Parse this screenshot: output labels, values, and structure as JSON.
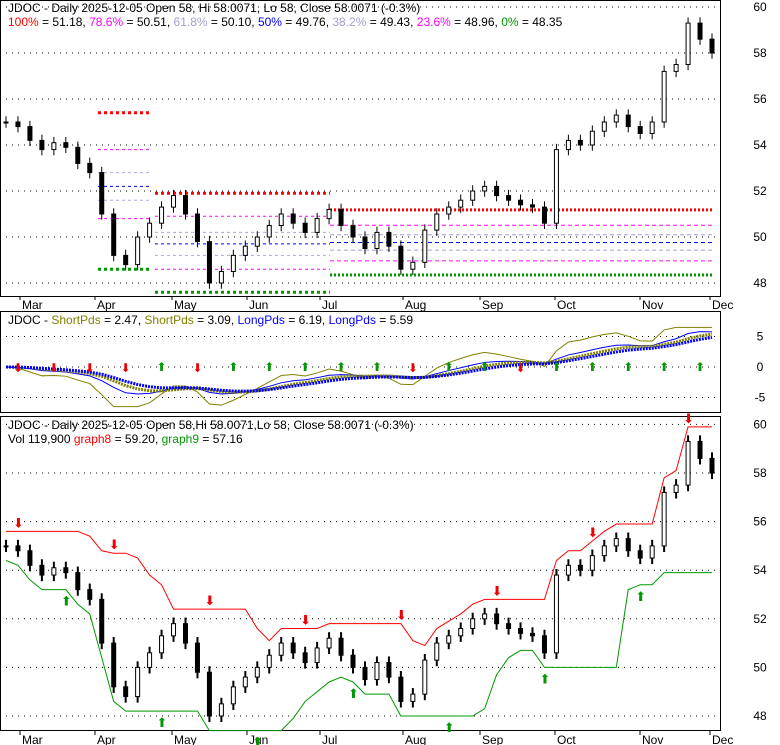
{
  "chart_data": {
    "type": "line",
    "panels": [
      {
        "name": "price",
        "title": "JDOC - Daily 2025-12-05 Open 58, Hi 58.0071, Lo 58, Close 58.0071 (-0.3%)",
        "ylim": [
          47.5,
          60.2
        ],
        "yticks": [
          "48",
          "50",
          "52",
          "54",
          "56",
          "58",
          "60"
        ]
      },
      {
        "name": "oscillator",
        "title": "JDOC",
        "ylim": [
          -7,
          7
        ],
        "yticks": [
          "5",
          "0",
          "-5"
        ]
      },
      {
        "name": "price-stops",
        "title": "JDOC - Daily 2025-12-05 Open 58,Hi 58.0071,Lo 58, Close 58.0071 (-0.3%)",
        "ylim": [
          47.5,
          60.2
        ],
        "yticks": [
          "48",
          "50",
          "52",
          "54",
          "56",
          "58",
          "60"
        ]
      }
    ],
    "xticks": [
      "Mar",
      "Apr",
      "May",
      "Jun",
      "Jul",
      "Aug",
      "Sep",
      "Oct",
      "Nov",
      "Dec"
    ],
    "closes": [
      55,
      54.8,
      54.2,
      53.8,
      54.1,
      53.9,
      53.2,
      52.8,
      51,
      49.2,
      48.8,
      50,
      50.6,
      51.3,
      51.8,
      51,
      49.8,
      48,
      48.5,
      49.2,
      49.6,
      50,
      50.5,
      51,
      50.6,
      50.2,
      50.8,
      51.2,
      50.5,
      50,
      49.5,
      50.2,
      49.6,
      48.6,
      48.9,
      50.3,
      51,
      51.3,
      51.6,
      52,
      52.2,
      51.8,
      51.6,
      51.4,
      51.3,
      50.6,
      53.8,
      54.2,
      54,
      54.6,
      55,
      55.3,
      54.8,
      54.5,
      55,
      57.2,
      57.5,
      59.3,
      58.6,
      58
    ],
    "fib_current": [
      {
        "label": "100%",
        "value": 51.18,
        "color": "#ff0000"
      },
      {
        "label": "78.6%",
        "value": 50.51,
        "color": "#ff00ff"
      },
      {
        "label": "61.8%",
        "value": 50.1,
        "color": "#a0a0d0"
      },
      {
        "label": "50%",
        "value": 49.76,
        "color": "#0000ff"
      },
      {
        "label": "38.2%",
        "value": 49.43,
        "color": "#a0a0d0"
      },
      {
        "label": "23.6%",
        "value": 48.96,
        "color": "#ff00ff"
      },
      {
        "label": "0%",
        "value": 48.35,
        "color": "#009900"
      }
    ],
    "oscillator_values": [
      {
        "label": "ShortPds",
        "value": "2.47",
        "color": "#808000"
      },
      {
        "label": "ShortPds",
        "value": "3.09",
        "color": "#808000"
      },
      {
        "label": "LongPds",
        "value": "6.19",
        "color": "#0000ff"
      },
      {
        "label": "LongPds",
        "value": "5.59",
        "color": "#0000ff"
      }
    ],
    "volume": "Vol 119,900",
    "graph8": {
      "label": "graph8",
      "value": "59.20",
      "color": "#ff0000"
    },
    "graph9": {
      "label": "graph9",
      "value": "57.16",
      "color": "#009900"
    }
  }
}
